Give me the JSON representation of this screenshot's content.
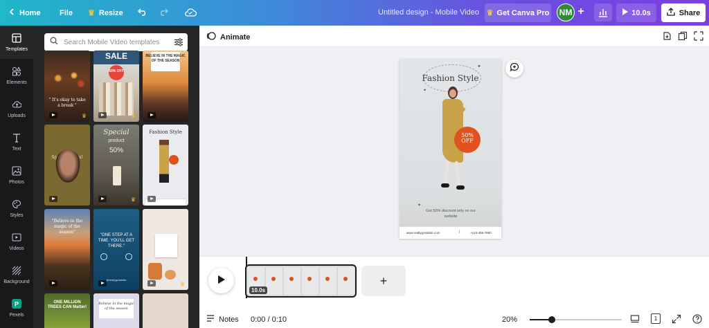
{
  "topbar": {
    "home": "Home",
    "file": "File",
    "resize": "Resize",
    "title": "Untitled design - Mobile Video",
    "get_pro": "Get Canva Pro",
    "avatar_initials": "NM",
    "play_duration": "10.0s",
    "share": "Share"
  },
  "rail": [
    {
      "label": "Templates",
      "icon": "templates-icon"
    },
    {
      "label": "Elements",
      "icon": "elements-icon"
    },
    {
      "label": "Uploads",
      "icon": "uploads-icon"
    },
    {
      "label": "Text",
      "icon": "text-icon"
    },
    {
      "label": "Photos",
      "icon": "photos-icon"
    },
    {
      "label": "Styles",
      "icon": "styles-icon"
    },
    {
      "label": "Videos",
      "icon": "videos-icon"
    },
    {
      "label": "Background",
      "icon": "background-icon"
    },
    {
      "label": "Pexels",
      "icon": "pexels-icon"
    }
  ],
  "search": {
    "placeholder": "Search Mobile Video templates"
  },
  "templates": {
    "t1": "\" It's okay to take a break \"",
    "t2_sale": "SALE",
    "t2_off": "50% OFF",
    "t3": "BELIEVE IN THE MAGIC OF THE SEASON",
    "t4": "Special Offers!",
    "t5a": "Special",
    "t5b": "product",
    "t5c": "50%",
    "t6": "Fashion Style",
    "t7": "\"Believe in the magic of the season\"",
    "t8": "\"ONE STEP AT A TIME. YOU'LL GET THERE.\"",
    "t8_handle": "@reallygreatsite",
    "t10": "ONE MILLION TREES CAN Matter!",
    "t11": "Believe in the magic of the season"
  },
  "editor": {
    "animate": "Animate"
  },
  "design": {
    "title": "Fashion Style",
    "badge_pct": "50%",
    "badge_off": "OFF",
    "caption": "Get 50% discount only on our website",
    "website": "www.reallygreatsite.com",
    "phone": "+123-456-7890"
  },
  "timeline": {
    "duration": "10.0s"
  },
  "footer": {
    "notes": "Notes",
    "time": "0:00 / 0:10",
    "zoom": "20%",
    "zoom_fraction": 0.2,
    "page_count": "1"
  },
  "colors": {
    "accent": "#7a3fe3",
    "badge": "#e0531f",
    "dress": "#c9a24a"
  }
}
